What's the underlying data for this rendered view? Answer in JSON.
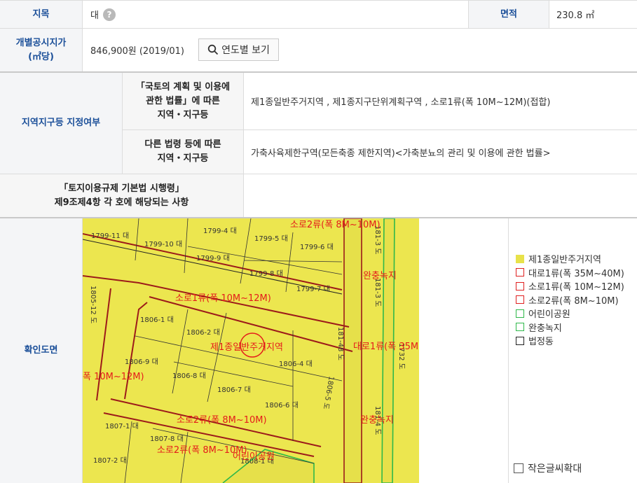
{
  "row1": {
    "jimok_label": "지목",
    "jimok_value": "대",
    "help_glyph": "?",
    "area_label": "면적",
    "area_value": "230.8 ㎡"
  },
  "row2": {
    "price_label_line1": "개별공시지가",
    "price_label_line2": "(㎡당)",
    "price_value": "846,900원 (2019/01)",
    "year_button": "연도별 보기"
  },
  "zoning": {
    "label": "지역지구등 지정여부",
    "law1_line1": "「국토의 계획 및 이용에",
    "law1_line2": "관한 법률」에 따른",
    "law1_line3": "지역・지구등",
    "law1_value": "제1종일반주거지역 , 제1종지구단위계획구역 , 소로1류(폭 10M~12M)(접합)",
    "law2_line1": "다른 법령 등에 따른",
    "law2_line2": "지역・지구등",
    "law2_value": "가축사육제한구역(모든축종 제한지역)<가축분뇨의 관리 및 이용에 관한 법률>"
  },
  "regulation": {
    "line1": "「토지이용규제 기본법 시행령」",
    "line2": "제9조제4항 각 호에 해당되는 사항",
    "value": ""
  },
  "map_section": {
    "label": "확인도면",
    "lots": [
      "1799-11 대",
      "1799-10 대",
      "1799-4 대",
      "1799-5 대",
      "1799-6 대",
      "1799-9 대",
      "1799-8 대",
      "1799-7 대",
      "1805-12 도",
      "1806-1 대",
      "1806-2 대",
      "1806-9 대",
      "1806-8 대",
      "1806-4 대",
      "1806-7 대",
      "1806-6 대",
      "1806-5 도",
      "1807-1 대",
      "1807-8 대",
      "1807-2 대",
      "1808-1 대",
      "181-48 도",
      "181-3 도",
      "1732 도",
      "181-4 도",
      "181-3 도"
    ],
    "labels": [
      "소로2류(폭 8M~10M)",
      "완충녹지",
      "소로1류(폭 10M~12M)",
      "제1종일반주거지역",
      "대로1류(폭 35M",
      "폭 10M~12M)",
      "소로2류(폭 8M~10M)",
      "완충녹지",
      "소로2류(폭 8M~10M)",
      "어린이공원"
    ],
    "legend": [
      {
        "label": "제1종일반주거지역",
        "color": "#e8e24a",
        "filled": true
      },
      {
        "label": "대로1류(폭 35M~40M)",
        "color": "#e02020",
        "filled": false
      },
      {
        "label": "소로1류(폭 10M~12M)",
        "color": "#e02020",
        "filled": false
      },
      {
        "label": "소로2류(폭 8M~10M)",
        "color": "#e02020",
        "filled": false
      },
      {
        "label": "어린이공원",
        "color": "#2fb84a",
        "filled": false
      },
      {
        "label": "완충녹지",
        "color": "#2fb84a",
        "filled": false
      },
      {
        "label": "법정동",
        "color": "#222222",
        "filled": false
      }
    ],
    "zoom_label": "작은글씨확대"
  }
}
